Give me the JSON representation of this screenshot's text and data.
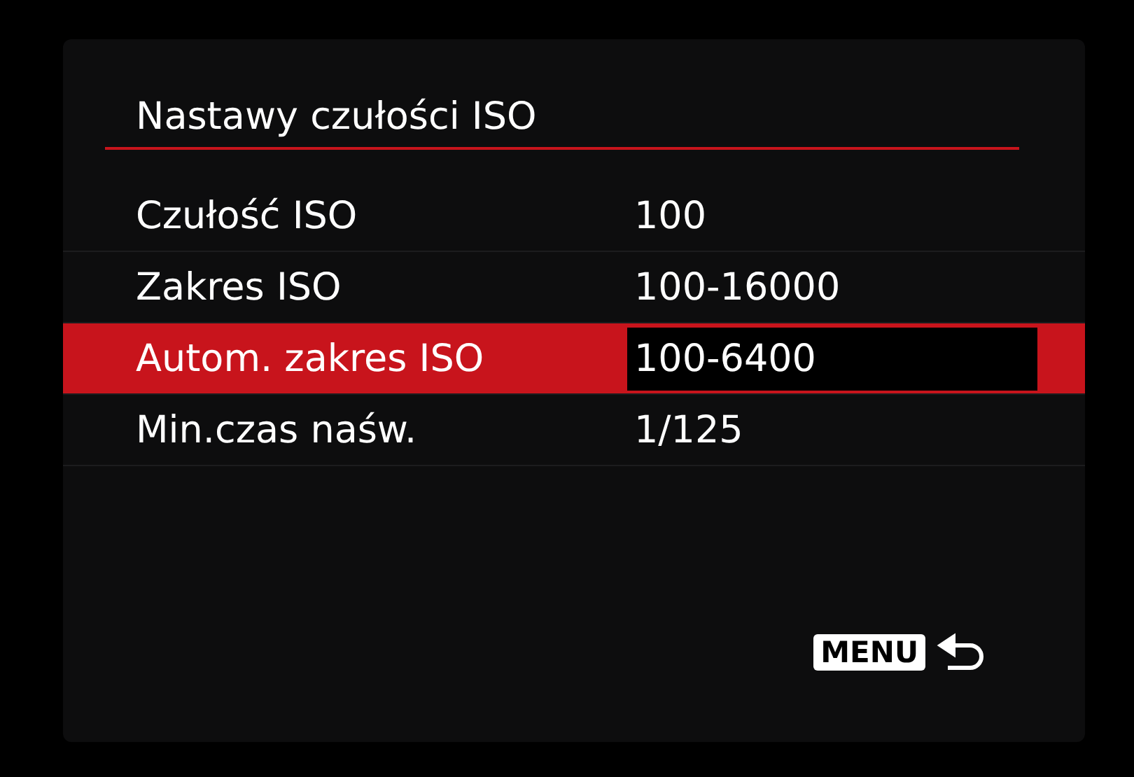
{
  "title": "Nastawy czułości ISO",
  "items": [
    {
      "label": "Czułość ISO",
      "value": "100",
      "selected": false
    },
    {
      "label": "Zakres ISO",
      "value": "100-16000",
      "selected": false
    },
    {
      "label": "Autom. zakres ISO",
      "value": "100-6400",
      "selected": true
    },
    {
      "label": "Min.czas naśw.",
      "value": "1/125",
      "selected": false
    }
  ],
  "menu_button": {
    "label": "MENU"
  }
}
